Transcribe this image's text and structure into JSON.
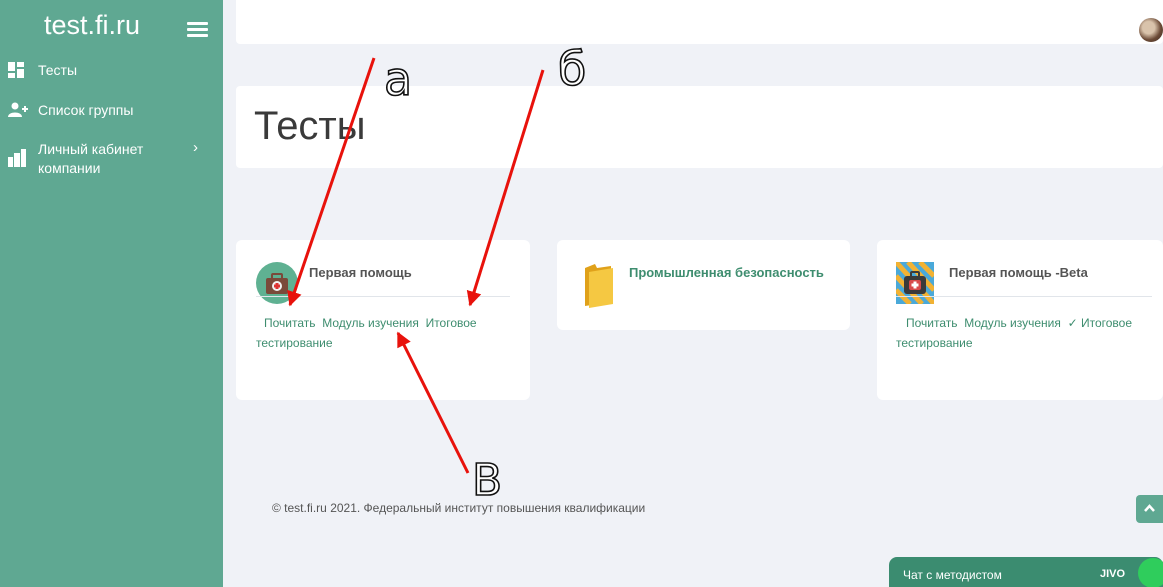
{
  "sidebar": {
    "brand": "test.fi.ru",
    "items": [
      {
        "label": "Тесты",
        "icon": "dashboard-icon"
      },
      {
        "label": "Список группы",
        "icon": "add-user-icon"
      },
      {
        "label": "Личный кабинет",
        "label2": "компании",
        "icon": "company-icon",
        "arrow": "›"
      }
    ]
  },
  "page": {
    "title": "Тесты"
  },
  "cards": [
    {
      "title": "Первая помощь",
      "links": [
        "Почитать",
        "Модуль изучения",
        "Итоговое тестирование"
      ],
      "icon": "first-aid-kit-icon"
    },
    {
      "title": "Промышленная безопасность",
      "links": [],
      "icon": "folder-icon"
    },
    {
      "title": "Первая помощь -Beta",
      "links": [
        "Почитать",
        "Модуль изучения",
        "Итоговое тестирование"
      ],
      "icon": "first-aid-kit-icon"
    }
  ],
  "footer": {
    "text": "© test.fi.ru 2021. Федеральный институт повышения квалификации"
  },
  "chat": {
    "label": "Чат с методистом",
    "brand": "JIVO"
  },
  "annotations": {
    "a": "а",
    "b": "б",
    "v": "В"
  },
  "colors": {
    "sidebar": "#5fa892",
    "accent": "#3e8d6f",
    "background": "#f0f2f7",
    "arrow": "#e8120c"
  }
}
